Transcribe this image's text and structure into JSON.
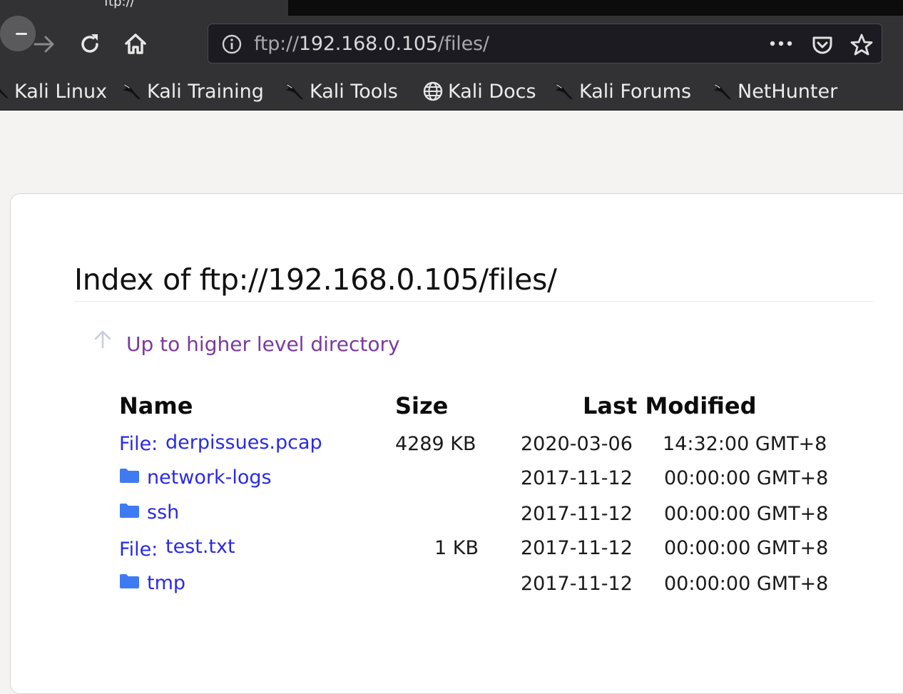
{
  "browser": {
    "tabs": [
      {
        "label": "ftp://"
      },
      {
        "label": ""
      }
    ],
    "url": {
      "scheme": "ftp://",
      "host": "192.168.0.105",
      "path": "/files/"
    },
    "bookmarks": [
      {
        "label": "Kali Linux",
        "icon": "kali-dragon-icon"
      },
      {
        "label": "Kali Training",
        "icon": "kali-dragon-icon"
      },
      {
        "label": "Kali Tools",
        "icon": "kali-dragon-icon"
      },
      {
        "label": "Kali Docs",
        "icon": "globe-icon"
      },
      {
        "label": "Kali Forums",
        "icon": "kali-dragon-icon"
      },
      {
        "label": "NetHunter",
        "icon": "kali-dragon-icon"
      }
    ]
  },
  "page": {
    "title": "Index of ftp://192.168.0.105/files/",
    "up_link": "Up to higher level directory",
    "columns": {
      "name": "Name",
      "size": "Size",
      "modified": "Last Modified"
    },
    "rows": [
      {
        "type": "file",
        "prefix": "File:",
        "name": "derpissues.pcap",
        "size": "4289 KB",
        "date": "2020-03-06",
        "time": "14:32:00 GMT+8"
      },
      {
        "type": "dir",
        "prefix": "",
        "name": "network-logs",
        "size": "",
        "date": "2017-11-12",
        "time": "00:00:00 GMT+8"
      },
      {
        "type": "dir",
        "prefix": "",
        "name": "ssh",
        "size": "",
        "date": "2017-11-12",
        "time": "00:00:00 GMT+8"
      },
      {
        "type": "file",
        "prefix": "File:",
        "name": "test.txt",
        "size": "1 KB",
        "date": "2017-11-12",
        "time": "00:00:00 GMT+8"
      },
      {
        "type": "dir",
        "prefix": "",
        "name": "tmp",
        "size": "",
        "date": "2017-11-12",
        "time": "00:00:00 GMT+8"
      }
    ]
  },
  "colors": {
    "link": "#2a2ae6",
    "visited_link": "#7b3aa0",
    "folder": "#3e7bf2",
    "chrome": "#323234"
  }
}
